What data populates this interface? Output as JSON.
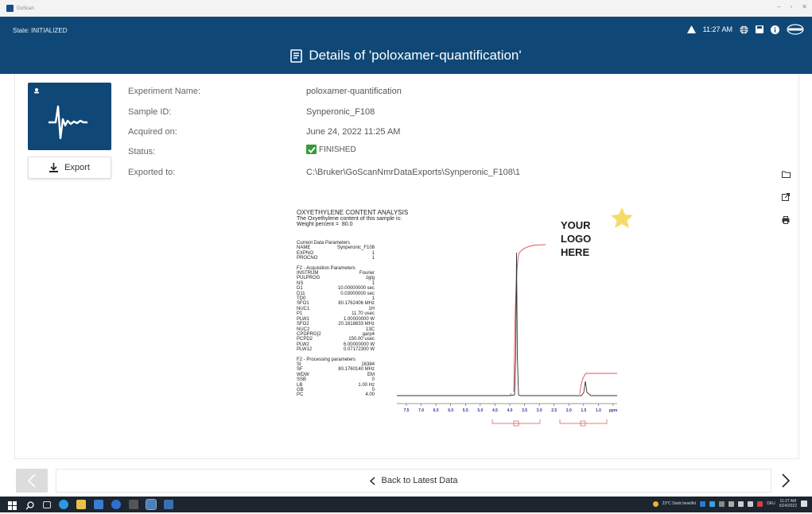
{
  "window": {
    "app_name": "GoScan"
  },
  "header": {
    "state": "State: INITIALIZED",
    "time": "11:27 AM",
    "title": "Details of 'poloxamer-quantification'",
    "accent_color": "#0f4877"
  },
  "actions": {
    "export_label": "Export"
  },
  "details": [
    {
      "label": "Experiment Name:",
      "value": "poloxamer-quantification"
    },
    {
      "label": "Sample ID:",
      "value": "Synperonic_F108"
    },
    {
      "label": "Acquired on:",
      "value": "June 24, 2022 11:25 AM"
    },
    {
      "label": "Status:",
      "value": "FINISHED"
    },
    {
      "label": "Exported to:",
      "value": "C:\\Bruker\\GoScanNmrDataExports\\Synperonic_F108\\1"
    }
  ],
  "report": {
    "heading": "OXYETHYLENE CONTENT ANALYSIS",
    "line2": "The Oxyethylene content of this sample is:",
    "line3": "Weight percent =  80.0",
    "logo": [
      "YOUR",
      "LOGO",
      "HERE"
    ],
    "sections": [
      {
        "title": "Current Data Parameters",
        "rows": [
          [
            "NAME",
            "Synperonic_F108"
          ],
          [
            "EXPNO",
            "1"
          ],
          [
            "PROCNO",
            "1"
          ]
        ]
      },
      {
        "title": "F2 - Acquisition Parameters",
        "rows": [
          [
            "INSTRUM",
            "Fourier"
          ],
          [
            "PULPROG",
            "zgig"
          ],
          [
            "NS",
            "1"
          ],
          [
            "D1",
            "10.00000000 sec"
          ],
          [
            "D11",
            "0.03000000 sec"
          ],
          [
            "TD0",
            "1"
          ],
          [
            "SFO1",
            "80.1762406 MHz"
          ],
          [
            "NUC1",
            "1H"
          ],
          [
            "P1",
            "11.70 usec"
          ],
          [
            "PLW1",
            "1.00000000 W"
          ],
          [
            "SFO2",
            "20.1618833 MHz"
          ],
          [
            "NUC2",
            "13C"
          ],
          [
            "CPDPRG[2",
            "garp4"
          ],
          [
            "PCPD2",
            "150.00 usec"
          ],
          [
            "PLW2",
            "6.00000000 W"
          ],
          [
            "PLW12",
            "0.07172300 W"
          ]
        ]
      },
      {
        "title": "F2 - Processing parameters",
        "rows": [
          [
            "SI",
            "16384"
          ],
          [
            "SF",
            "80.1760140 MHz"
          ],
          [
            "WDW",
            "EM"
          ],
          [
            "SSB",
            "0"
          ],
          [
            "LB",
            "1.00 Hz"
          ],
          [
            "GB",
            "0"
          ],
          [
            "PC",
            "4.00"
          ]
        ]
      }
    ],
    "axis_ticks": [
      "7.5",
      "7.0",
      "6.5",
      "6.0",
      "5.5",
      "5.0",
      "4.5",
      "4.0",
      "3.5",
      "3.0",
      "2.5",
      "2.0",
      "1.5",
      "1.0",
      "ppm"
    ]
  },
  "nav": {
    "back_label": "Back to Latest Data"
  },
  "taskbar": {
    "weather": "23°C  Stark bewölkt",
    "lang": "DEU",
    "clock_time": "11:27 AM",
    "clock_date": "6/24/2022"
  }
}
